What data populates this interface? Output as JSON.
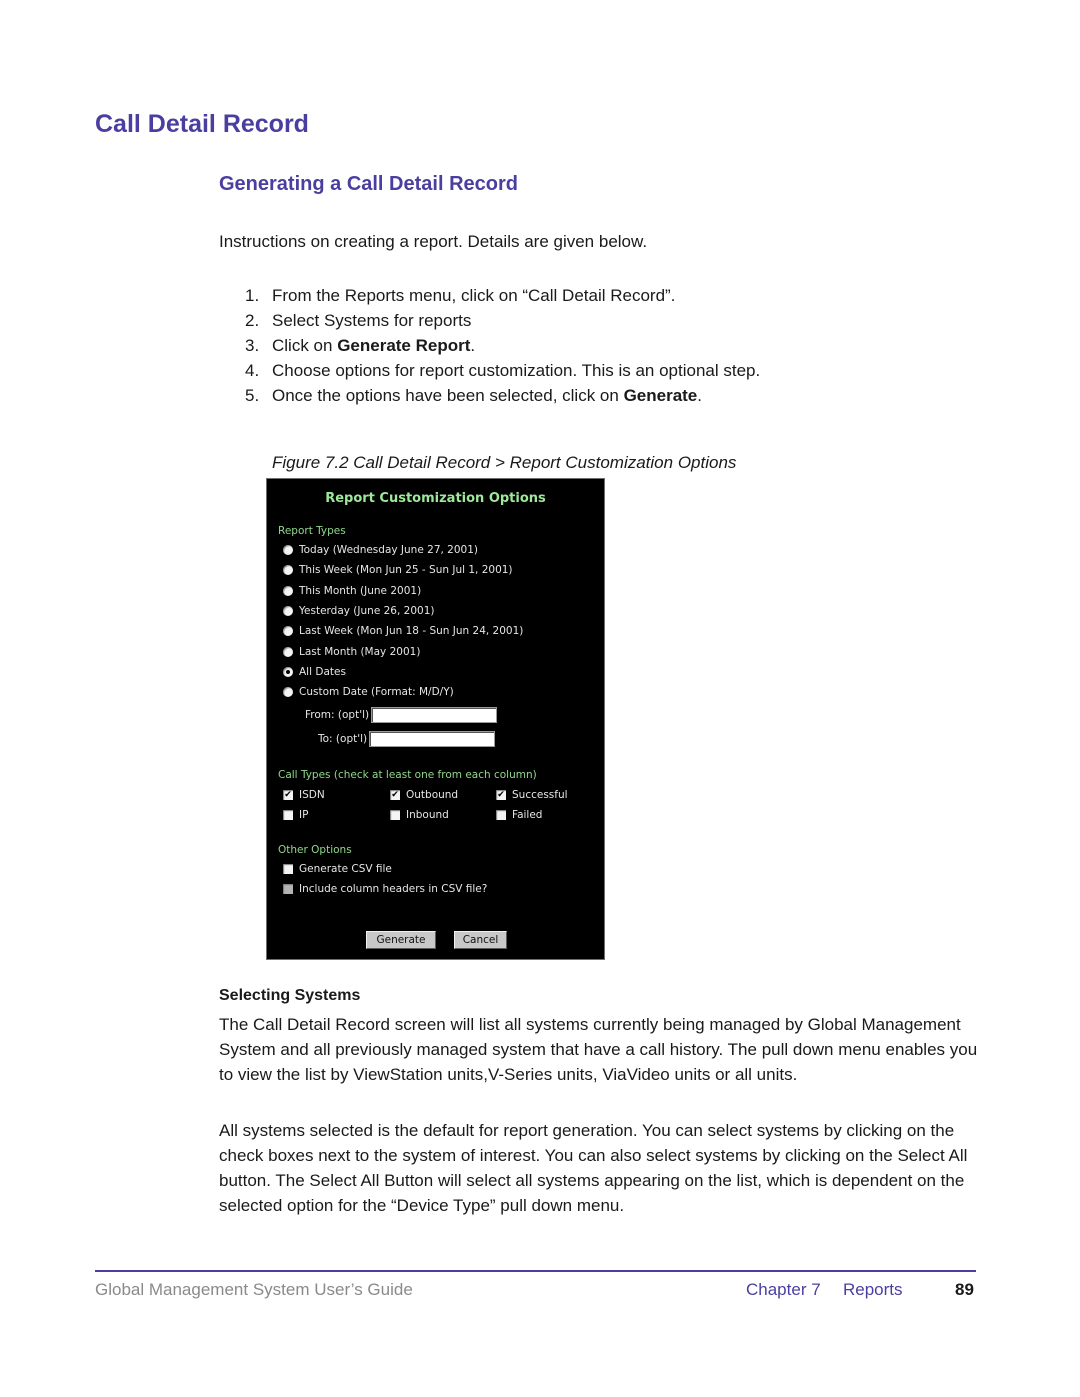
{
  "page": {
    "title": "Call Detail Record",
    "subtitle": "Generating a Call Detail Record",
    "intro": "Instructions on creating a report. Details are given below.",
    "steps": [
      {
        "num": "1.",
        "pre": "From the Reports menu, click on “Call Detail Record”.",
        "bold": "",
        "post": ""
      },
      {
        "num": "2.",
        "pre": "Select Systems for reports",
        "bold": "",
        "post": ""
      },
      {
        "num": "3.",
        "pre": "Click on ",
        "bold": "Generate Report",
        "post": "."
      },
      {
        "num": "4.",
        "pre": "Choose options for report customization. This is an optional step.",
        "bold": "",
        "post": ""
      },
      {
        "num": "5.",
        "pre": "Once the options have been selected, click on ",
        "bold": "Generate",
        "post": "."
      }
    ],
    "figure_caption": "Figure 7.2 Call Detail Record > Report Customization Options",
    "selecting_heading": "Selecting Systems",
    "paragraph1": "The Call Detail Record screen will list all systems currently being managed by Global Management System and all previously managed system that have a call history. The pull down menu enables you to view the list by ViewStation units,V-Series units, ViaVideo units or all units.",
    "paragraph2": "All systems selected is the default for report generation. You can select systems by clicking on the check boxes next to the system of interest. You can also select systems by clicking on the Select All button. The Select All Button will select all systems appearing on the list, which is dependent on the selected option for the “Device Type” pull down menu."
  },
  "figure": {
    "title": "Report Customization Options",
    "report_types_label": "Report Types",
    "report_types": [
      {
        "label": "Today (Wednesday June 27, 2001)",
        "selected": false
      },
      {
        "label": "This Week (Mon Jun 25 - Sun Jul 1, 2001)",
        "selected": false
      },
      {
        "label": "This Month (June 2001)",
        "selected": false
      },
      {
        "label": "Yesterday (June 26, 2001)",
        "selected": false
      },
      {
        "label": "Last Week (Mon Jun 18 - Sun Jun 24, 2001)",
        "selected": false
      },
      {
        "label": "Last Month (May 2001)",
        "selected": false
      },
      {
        "label": "All Dates",
        "selected": true
      },
      {
        "label": "Custom Date (Format: M/D/Y)",
        "selected": false
      }
    ],
    "from_label": "From: (opt'l)",
    "from_value": "",
    "to_label": "To: (opt'l)",
    "to_value": "",
    "call_types_label": "Call Types (check at least one from each column)",
    "call_types": [
      {
        "label": "ISDN",
        "checked": true
      },
      {
        "label": "Outbound",
        "checked": true
      },
      {
        "label": "Successful",
        "checked": true
      },
      {
        "label": "IP",
        "checked": false
      },
      {
        "label": "Inbound",
        "checked": false
      },
      {
        "label": "Failed",
        "checked": false
      }
    ],
    "other_options_label": "Other Options",
    "other_options": [
      {
        "label": "Generate CSV file",
        "checked": false,
        "disabled": false
      },
      {
        "label": "Include column headers in CSV file?",
        "checked": false,
        "disabled": true
      }
    ],
    "generate_button": "Generate",
    "cancel_button": "Cancel"
  },
  "footer": {
    "guide_title": "Global Management System User’s Guide",
    "chapter": "Chapter 7",
    "section": "Reports",
    "page_number": "89"
  },
  "colors": {
    "heading": "#4a3fa0",
    "figure_background": "#000000",
    "figure_accent": "#9ee89a"
  }
}
